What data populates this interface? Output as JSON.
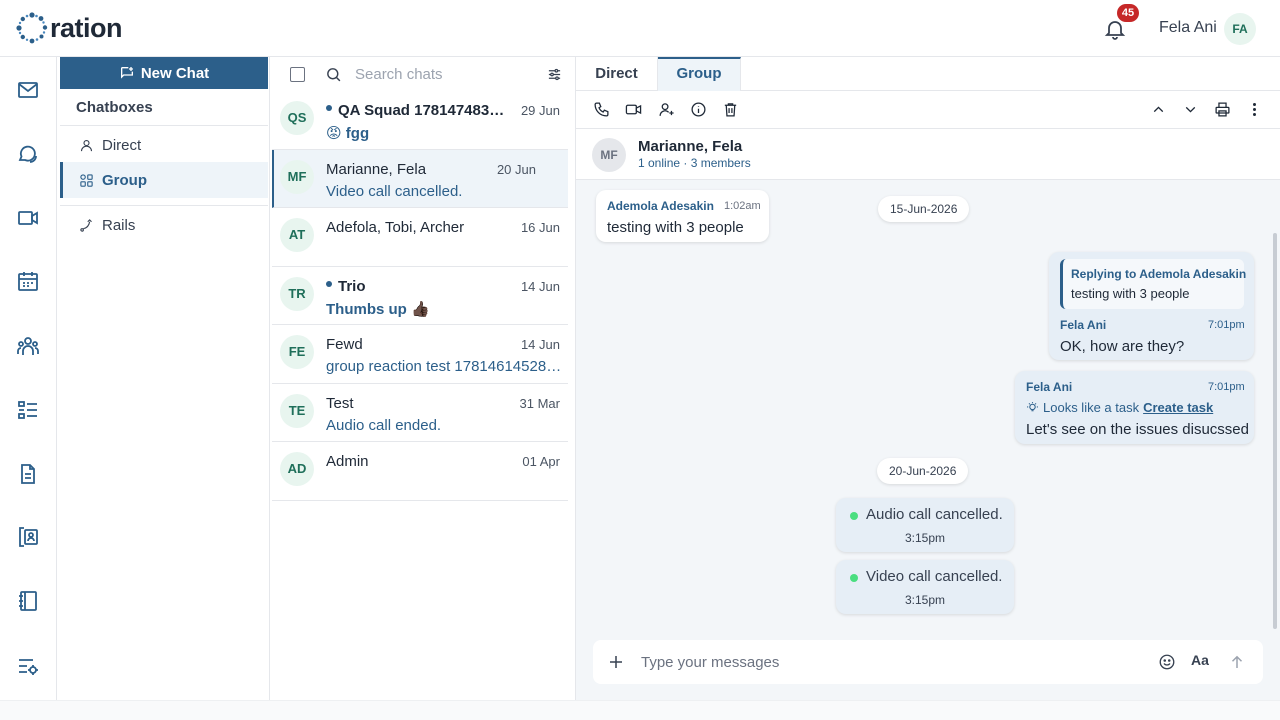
{
  "app": {
    "logo_text": "ration",
    "notifications_count": "45",
    "user_name": "Fela Ani",
    "user_initials": "FA"
  },
  "chatboxes": {
    "new_chat_label": "New Chat",
    "title": "Chatboxes",
    "items": [
      {
        "label": "Direct",
        "icon": "user-icon"
      },
      {
        "label": "Group",
        "icon": "group-icon",
        "active": true
      },
      {
        "label": "Rails",
        "icon": "rails-icon"
      }
    ]
  },
  "chatlist": {
    "search_placeholder": "Search chats",
    "items": [
      {
        "initials": "QS",
        "name": "QA Squad 1781474834...",
        "date": "29 Jun",
        "preview": "😡 fgg",
        "unread": true
      },
      {
        "initials": "MF",
        "name": "Marianne, Fela",
        "date": "20 Jun",
        "preview": "Video call cancelled.",
        "selected": true
      },
      {
        "initials": "AT",
        "name": "Adefola, Tobi, Archer",
        "date": "16 Jun",
        "preview": ""
      },
      {
        "initials": "TR",
        "name": "Trio",
        "date": "14 Jun",
        "preview": "Thumbs up 👍🏿",
        "unread": true
      },
      {
        "initials": "FE",
        "name": "Fewd",
        "date": "14 Jun",
        "preview": "group reaction test 1781461452884"
      },
      {
        "initials": "TE",
        "name": "Test",
        "date": "31 Mar",
        "preview": "Audio call ended."
      },
      {
        "initials": "AD",
        "name": "Admin",
        "date": "01 Apr",
        "preview": ""
      }
    ]
  },
  "conversation": {
    "tabs": [
      "Direct",
      "Group"
    ],
    "active_tab": "Group",
    "header": {
      "initials": "MF",
      "title": "Marianne, Fela",
      "subtitle": "1 online · 3 members"
    },
    "messages": {
      "m1": {
        "sender": "Ademola Adesakin",
        "time": "1:02am",
        "text": "testing with 3 people"
      },
      "date1": "15-Jun-2026",
      "m2": {
        "reply_label": "Replying to Ademola Adesakin",
        "reply_text": "testing with 3 people",
        "sender": "Fela Ani",
        "time": "7:01pm",
        "text": "OK, how are they?"
      },
      "m3": {
        "sender": "Fela Ani",
        "time": "7:01pm",
        "task_hint": "Looks like a task",
        "task_link": "Create task",
        "text": "Let's see on the issues disucssed"
      },
      "date2": "20-Jun-2026",
      "call1": {
        "text": "Audio call cancelled.",
        "time": "3:15pm"
      },
      "call2": {
        "text": "Video call cancelled.",
        "time": "3:15pm"
      }
    },
    "composer": {
      "placeholder": "Type your messages",
      "format_label": "Aa"
    }
  },
  "colors": {
    "accent": "#2c5f8a",
    "badge": "#c62828",
    "online": "#4ade80"
  }
}
